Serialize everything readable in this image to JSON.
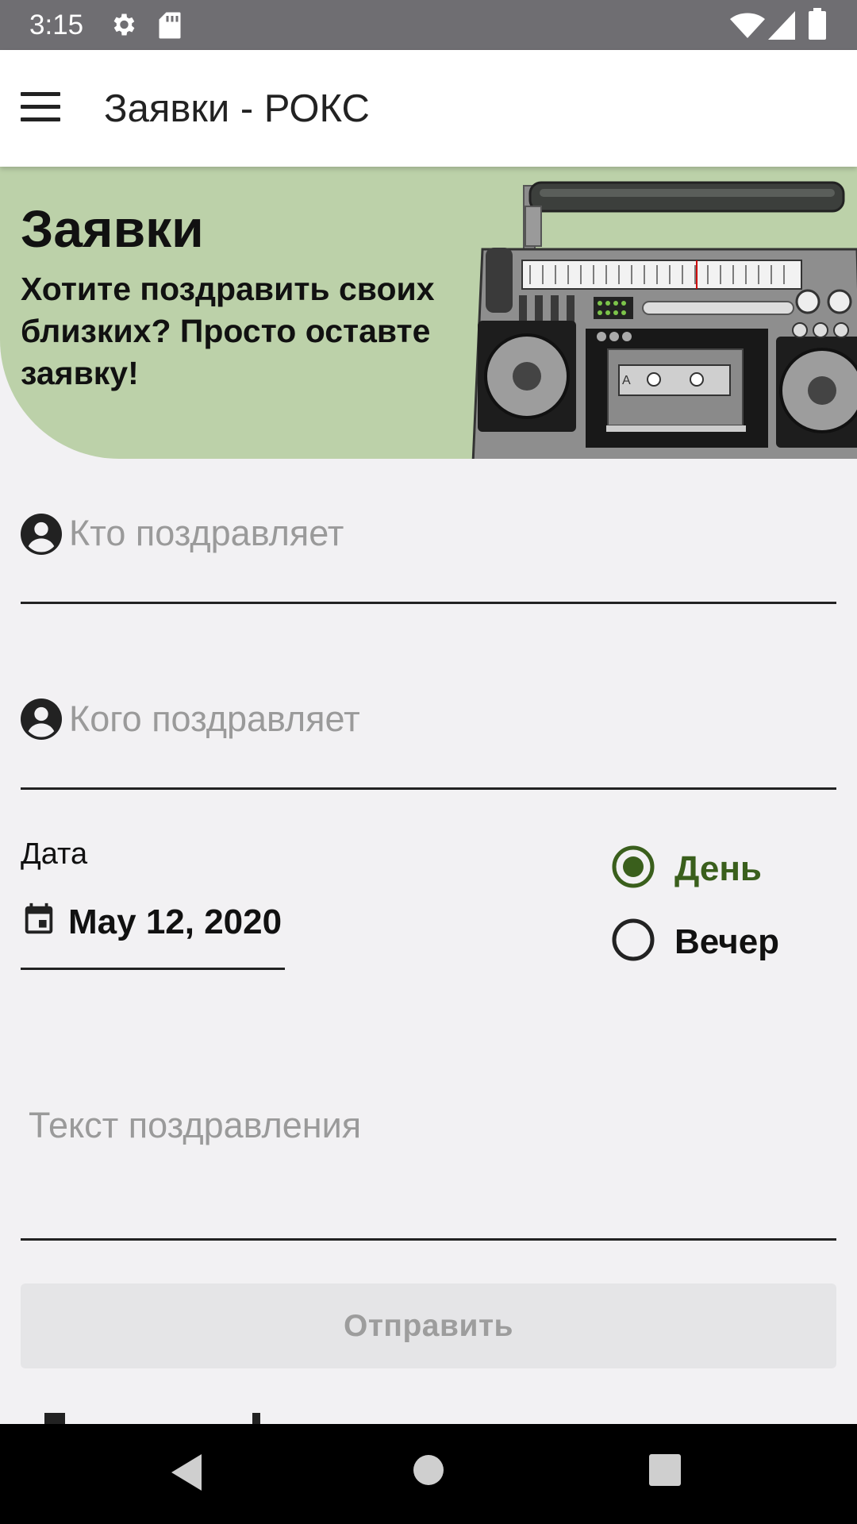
{
  "status_bar": {
    "time": "3:15",
    "icons": [
      "gear-icon",
      "sd-card-icon",
      "wifi-icon",
      "signal-icon",
      "battery-icon"
    ]
  },
  "app_bar": {
    "menu_icon": "hamburger-icon",
    "title": "Заявки - РОКС"
  },
  "banner": {
    "heading": "Заявки",
    "subtitle": "Хотите поздравить своих близких? Просто оставте заявку!",
    "image": "boombox-illustration",
    "background": "#bcd1a9"
  },
  "form": {
    "from_field": {
      "placeholder": "Кто поздравляет",
      "value": "",
      "icon": "person-icon"
    },
    "to_field": {
      "placeholder": "Кого поздравляет",
      "value": "",
      "icon": "person-icon"
    },
    "date": {
      "label": "Дата",
      "value": "May 12, 2020",
      "icon": "calendar-icon"
    },
    "time_of_day": {
      "options": [
        {
          "label": "День",
          "selected": true
        },
        {
          "label": "Вечер",
          "selected": false
        }
      ],
      "accent": "#3a5f1c"
    },
    "message_field": {
      "placeholder": "Текст поздравления",
      "value": ""
    },
    "submit_label": "Отправить"
  },
  "nav_bar": {
    "buttons": [
      "back-icon",
      "home-icon",
      "recents-icon"
    ]
  }
}
